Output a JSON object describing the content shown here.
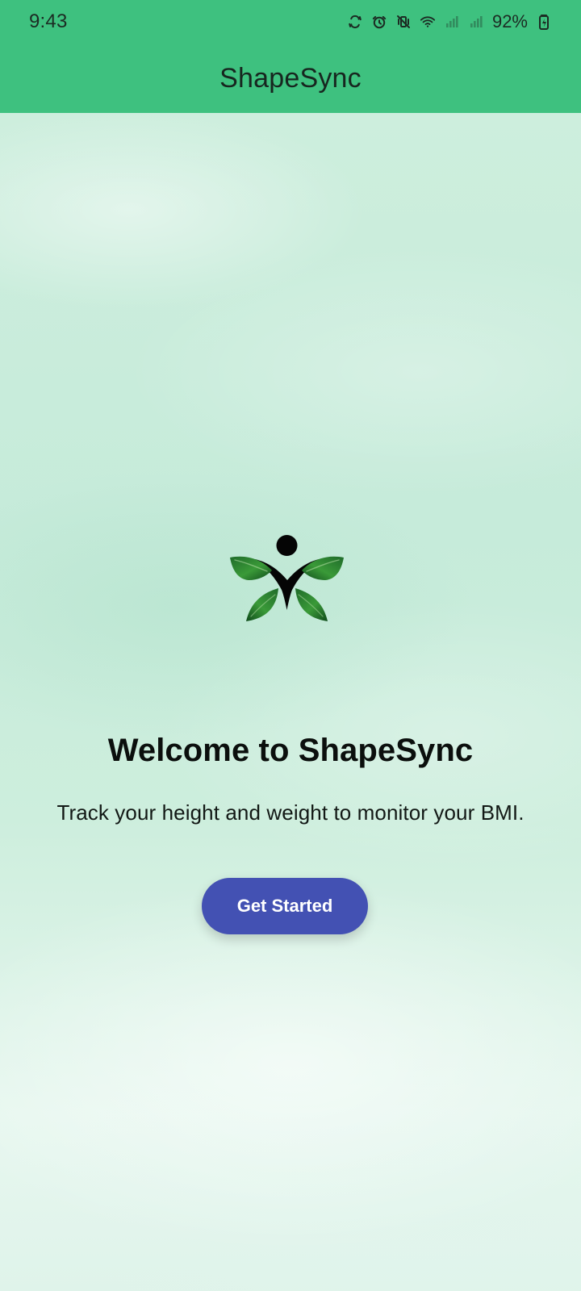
{
  "status_bar": {
    "time": "9:43",
    "battery_percent": "92%",
    "icons": [
      "android-recycle-icon",
      "alarm-icon",
      "vibrate-off-icon",
      "wifi-icon",
      "signal-1-icon",
      "signal-2-icon",
      "battery-charging-icon"
    ]
  },
  "app_bar": {
    "title": "ShapeSync",
    "background_color": "#3ec17f"
  },
  "hero": {
    "logo_icon": "butterfly-person-logo",
    "heading": "Welcome to ShapeSync",
    "subtitle": "Track your height and weight to monitor your BMI.",
    "cta_label": "Get Started",
    "cta_color": "#4351b3"
  }
}
